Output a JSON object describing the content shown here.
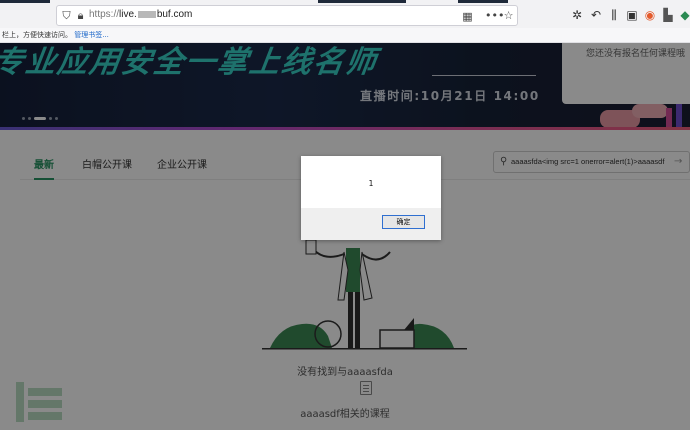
{
  "browser": {
    "url_scheme": "https://",
    "url_prefix": "live.",
    "url_suffix": "buf.com",
    "bookmarks_hint": "栏上，方便快速访问。",
    "bookmarks_link": "管理书签..."
  },
  "banner": {
    "headline": "专业应用安全一掌上线名师",
    "live_time": "直播时间:10月21日 14:00",
    "side_card_text": "您还没有报名任何课程哦"
  },
  "tabs": [
    {
      "label": "最新",
      "active": true
    },
    {
      "label": "白帽公开课",
      "active": false
    },
    {
      "label": "企业公开课",
      "active": false
    }
  ],
  "search": {
    "value": "aaaasfda<img src=1 onerror=alert(1)>aaaasdf"
  },
  "empty_state": {
    "line1": "没有找到与aaaasfda",
    "line2": "aaaasdf相关的课程"
  },
  "dialog": {
    "message": "1",
    "ok_label": "确定"
  },
  "colors": {
    "accent_green": "#2a9464",
    "banner_teal": "#38d3c8",
    "dialog_focus": "#2f6fd0"
  }
}
